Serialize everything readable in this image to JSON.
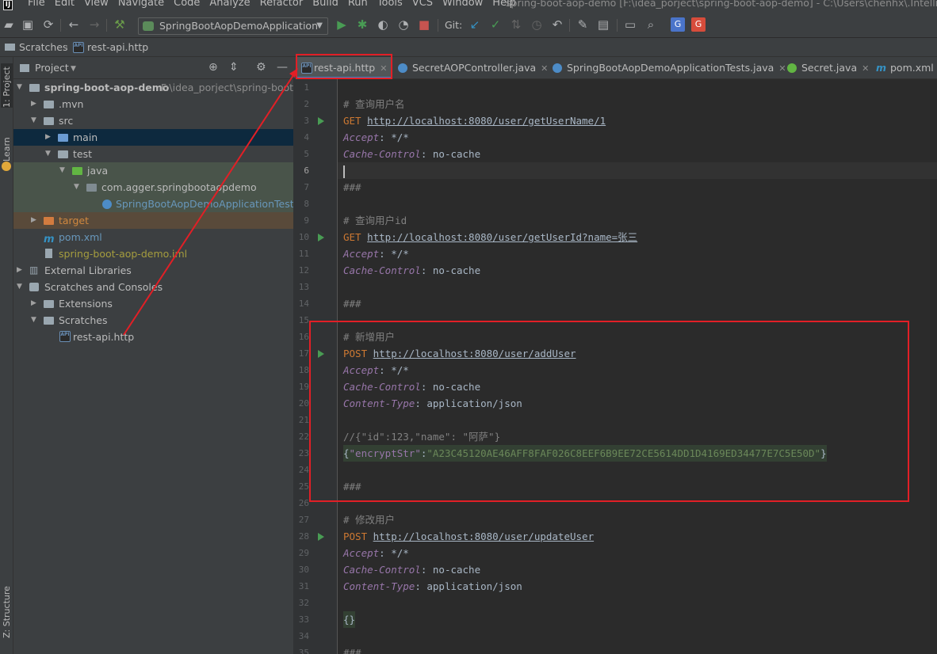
{
  "menu": {
    "items": [
      "File",
      "Edit",
      "View",
      "Navigate",
      "Code",
      "Analyze",
      "Refactor",
      "Build",
      "Run",
      "Tools",
      "VCS",
      "Window",
      "Help"
    ],
    "window_title": "spring-boot-aop-demo [F:\\idea_porject\\spring-boot-aop-demo] - C:\\Users\\chenhx\\.IntelliJIde"
  },
  "toolbar": {
    "run_config": "SpringBootAopDemoApplication",
    "git_label": "Git:"
  },
  "breadcrumb": {
    "root": "Scratches",
    "file": "rest-api.http"
  },
  "left_strip": {
    "project": "1: Project",
    "learn": "Learn",
    "structure": "Z: Structure"
  },
  "project_panel": {
    "title": "Project"
  },
  "tree": [
    {
      "label": "spring-boot-aop-demo",
      "path": "F:\\idea_porject\\spring-boot-a",
      "bold": true,
      "icon": "folder-icon"
    },
    {
      "label": ".mvn",
      "icon": "folder-icon"
    },
    {
      "label": "src",
      "icon": "folder-icon"
    },
    {
      "label": "main",
      "icon": "folder-icon"
    },
    {
      "label": "test",
      "icon": "folder-icon"
    },
    {
      "label": "java",
      "icon": "folder-icon"
    },
    {
      "label": "com.agger.springbootaopdemo",
      "icon": "package-icon"
    },
    {
      "label": "SpringBootAopDemoApplicationTests",
      "icon": "class-icon"
    },
    {
      "label": "target",
      "icon": "folder-icon"
    },
    {
      "label": "pom.xml",
      "icon": "maven-icon"
    },
    {
      "label": "spring-boot-aop-demo.iml",
      "icon": "iml-icon"
    },
    {
      "label": "External Libraries",
      "icon": "library-icon"
    },
    {
      "label": "Scratches and Consoles",
      "icon": "scratches-icon"
    },
    {
      "label": "Extensions",
      "icon": "folder-icon"
    },
    {
      "label": "Scratches",
      "icon": "folder-icon"
    },
    {
      "label": "rest-api.http",
      "icon": "http-file-icon"
    }
  ],
  "tabs": [
    "rest-api.http",
    "SecretAOPController.java",
    "SpringBootAopDemoApplicationTests.java",
    "Secret.java",
    "pom.xml"
  ],
  "line_numbers": [
    "1",
    "2",
    "3",
    "4",
    "5",
    "6",
    "7",
    "8",
    "9",
    "10",
    "11",
    "12",
    "13",
    "14",
    "15",
    "16",
    "17",
    "18",
    "19",
    "20",
    "21",
    "22",
    "23",
    "24",
    "25",
    "26",
    "27",
    "28",
    "29",
    "30",
    "31",
    "32",
    "33",
    "34",
    "35"
  ],
  "code": {
    "l2": "# 查询用户名",
    "l3m": "GET",
    "l3u": "http://localhost:8080/user/getUserName/1",
    "accept_key": "Accept",
    "accept_val": ": */*",
    "cache_key": "Cache-Control",
    "cache_val": ": no-cache",
    "ct_key": "Content-Type",
    "ct_val": ": application/json",
    "sep": "###",
    "l9": "# 查询用户id",
    "l10m": "GET",
    "l10u": "http://localhost:8080/user/getUserId?name=张三",
    "l16": "# 新增用户",
    "l17m": "POST",
    "l17u": "http://localhost:8080/user/addUser",
    "l22": "//{\"id\":123,\"name\": \"阿萨\"}",
    "l23_open": "{",
    "l23_key": "\"encryptStr\"",
    "l23_colon": ":",
    "l23_val": "\"A23C45120AE46AFF8FAF026C8EEF6B9EE72CE5614DD1D4169ED34477E7C5E50D\"",
    "l23_close": "}",
    "l27": "# 修改用户",
    "l28m": "POST",
    "l28u": "http://localhost:8080/user/updateUser",
    "l33": "{}"
  },
  "colors": {
    "annotation": "#e21f26",
    "run_gutter": "#499c54"
  }
}
